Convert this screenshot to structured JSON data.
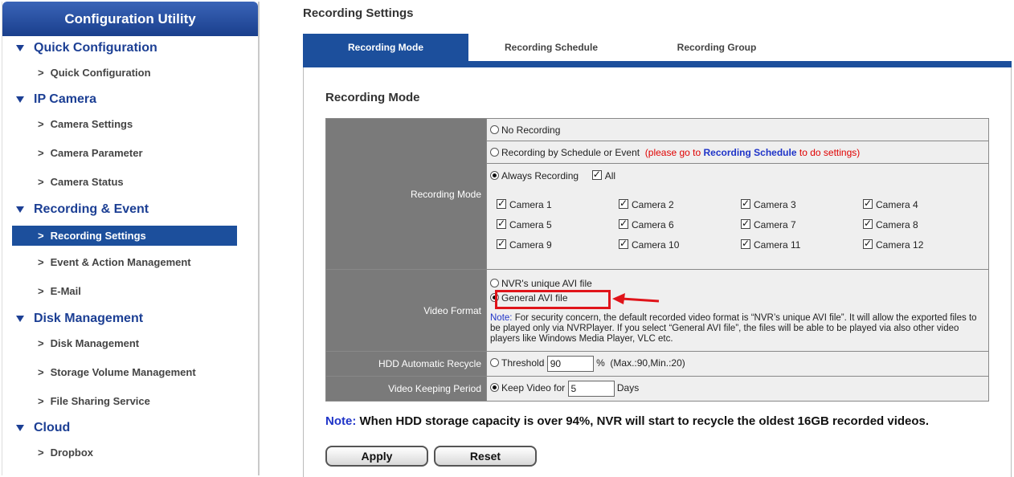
{
  "sidebar": {
    "title": "Configuration Utility",
    "sections": [
      {
        "label": "Quick Configuration",
        "items": [
          "Quick Configuration"
        ]
      },
      {
        "label": "IP Camera",
        "items": [
          "Camera Settings",
          "Camera Parameter",
          "Camera Status"
        ]
      },
      {
        "label": "Recording & Event",
        "items": [
          "Recording Settings",
          "Event & Action Management",
          "E-Mail"
        ]
      },
      {
        "label": "Disk Management",
        "items": [
          "Disk Management",
          "Storage Volume Management",
          "File Sharing Service"
        ]
      },
      {
        "label": "Cloud",
        "items": [
          "Dropbox"
        ]
      }
    ],
    "active_item": "Recording Settings",
    "chevron": ">"
  },
  "page_title": "Recording Settings",
  "tabs": [
    {
      "label": "Recording Mode",
      "active": true
    },
    {
      "label": "Recording Schedule",
      "active": false
    },
    {
      "label": "Recording Group",
      "active": false
    }
  ],
  "section_title": "Recording Mode",
  "recording_mode": {
    "label": "Recording Mode",
    "opt_no_recording": "No Recording",
    "opt_schedule": "Recording by Schedule or Event",
    "schedule_hint_pre": "(please go to ",
    "schedule_hint_link": "Recording Schedule",
    "schedule_hint_post": " to do settings)",
    "opt_always": "Always Recording",
    "all_label": "All",
    "selected": "Always Recording",
    "cameras": [
      "Camera 1",
      "Camera 2",
      "Camera 3",
      "Camera 4",
      "Camera 5",
      "Camera 6",
      "Camera 7",
      "Camera 8",
      "Camera 9",
      "Camera 10",
      "Camera 11",
      "Camera 12"
    ]
  },
  "video_format": {
    "label": "Video Format",
    "opt_unique": "NVR's unique AVI file",
    "opt_general": "General AVI file",
    "selected": "General AVI file",
    "note_label": "Note:",
    "note_text": " For security concern, the default recorded video format is “NVR’s unique AVI file”. It will allow the exported files to be played only via NVRPlayer. If you select “General AVI file”, the files will be able to be played via also other video players like Windows Media Player, VLC etc."
  },
  "hdd_recycle": {
    "label": "HDD Automatic Recycle",
    "opt_label": "Threshold",
    "value": "90",
    "unit": "%",
    "range": "(Max.:90,Min.:20)"
  },
  "keeping_period": {
    "label": "Video Keeping Period",
    "opt_label": "Keep Video for",
    "value": "5",
    "unit": "Days"
  },
  "bottom_note": {
    "label": "Note:",
    "text": " When HDD storage capacity is over 94%, NVR will start to recycle the oldest 16GB recorded videos."
  },
  "buttons": {
    "apply": "Apply",
    "reset": "Reset"
  },
  "colors": {
    "nav_blue": "#1c4f9c",
    "header_blue": "#1c3f94",
    "highlight_red": "#e0141a",
    "label_gray": "#7a7a7a"
  }
}
